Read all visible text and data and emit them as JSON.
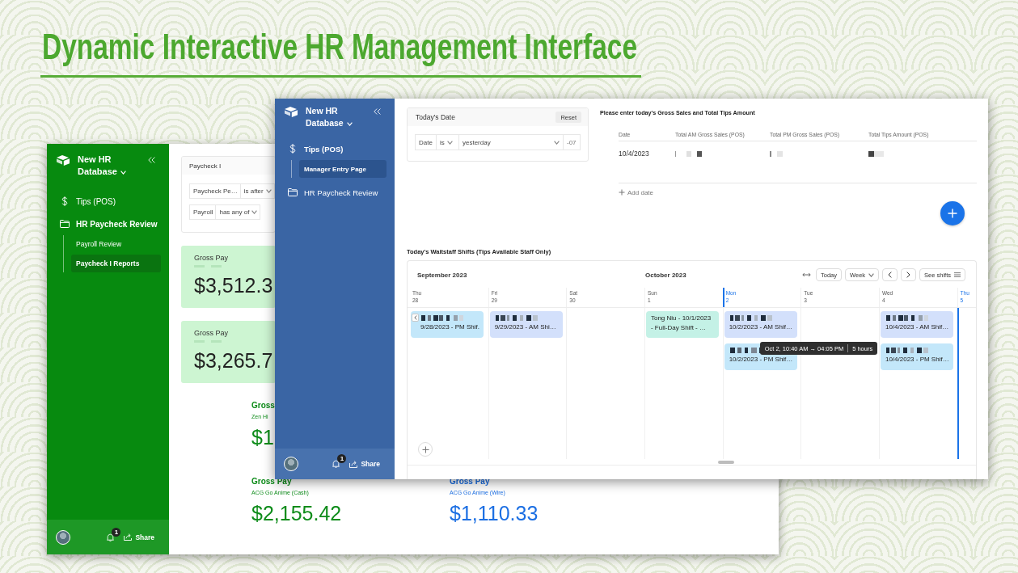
{
  "title": "Dynamic Interactive HR Management Interface",
  "back_window": {
    "sidebar": {
      "workspace": "New HR Database",
      "items": [
        {
          "kind": "dollar",
          "label": "Tips (POS)"
        },
        {
          "kind": "folder",
          "label": "HR Paycheck Review",
          "children": [
            {
              "label": "Payroll Review",
              "selected": false
            },
            {
              "label": "Paycheck I Reports",
              "selected": true
            }
          ]
        }
      ],
      "notification_count": "1",
      "share": "Share"
    },
    "filter_panel": {
      "title": "Paycheck I",
      "filters": [
        {
          "field": "Paycheck Pe…",
          "operator": "is after"
        },
        {
          "field": "Payroll",
          "operator": "has any of"
        }
      ]
    },
    "cards": [
      {
        "label": "Gross Pay",
        "subtitle_redacted": true,
        "value": "$3,512.3"
      },
      {
        "label": "Gross Pay",
        "subtitle_redacted": true,
        "value": "$3,265.7"
      }
    ],
    "metric_rows": [
      [
        {
          "label": "Gross",
          "subtitle": "Zen Hi",
          "value": "$1",
          "color": "#0e8c1a"
        }
      ],
      [
        {
          "label": "Gross Pay",
          "subtitle": "ACG Go Anime (Cash)",
          "value": "$2,155.42",
          "color": "#0e8c1a"
        },
        {
          "label": "Gross Pay",
          "subtitle": "ACG Go Anime (Wire)",
          "value": "$1,110.33",
          "color": "#1c6fe3"
        }
      ]
    ]
  },
  "front_window": {
    "sidebar": {
      "workspace": "New HR Database",
      "items": [
        {
          "kind": "dollar",
          "label": "Tips (POS)",
          "children": [
            {
              "label": "Manager Entry Page",
              "selected": true
            }
          ]
        },
        {
          "kind": "folder",
          "label": "HR Paycheck Review"
        }
      ],
      "notification_count": "1",
      "share": "Share"
    },
    "date_filter": {
      "title": "Today's Date",
      "reset": "Reset",
      "filters": [
        {
          "field": "Date",
          "operator": "is",
          "value": "yesterday",
          "suffix": "-07"
        }
      ]
    },
    "sales_entry": {
      "heading": "Please enter today's Gross Sales and Total Tips Amount",
      "columns": [
        "Date",
        "Total AM Gross Sales (POS)",
        "Total PM Gross Sales (POS)",
        "Total Tips Amount (POS)"
      ],
      "rows": [
        {
          "cells": [
            {
              "kind": "text",
              "text": "10/4/2023"
            },
            {
              "kind": "redacted"
            },
            {
              "kind": "redacted"
            },
            {
              "kind": "redacted"
            }
          ]
        }
      ],
      "add_label": "Add date"
    },
    "shifts": {
      "heading": "Today's Waitstaff Shifts (Tips Available Staff Only)",
      "calendar": {
        "months": [
          "September 2023",
          "October 2023"
        ],
        "today_button": "Today",
        "view": "Week",
        "see_shifts": "See shifts",
        "days": [
          {
            "name": "Thu",
            "date": "28",
            "highlighted": false,
            "day_marker": false,
            "now_line": false,
            "shifts": [
              {
                "redacted": true,
                "continued": true,
                "text": "9/28/2023 - PM Shif.",
                "color": "#c3e7fa"
              }
            ]
          },
          {
            "name": "Fri",
            "date": "29",
            "highlighted": false,
            "day_marker": false,
            "now_line": false,
            "shifts": [
              {
                "redacted": true,
                "continued": false,
                "text": "9/29/2023 - AM Shi…",
                "color": "#d3e0fb"
              }
            ]
          },
          {
            "name": "Sat",
            "date": "30",
            "highlighted": false,
            "day_marker": false,
            "now_line": false
          },
          {
            "name": "Sun",
            "date": "1",
            "highlighted": false,
            "day_marker": false,
            "now_line": false,
            "shifts": [
              {
                "redacted": false,
                "continued": false,
                "text": "Tong Niu - 10/1/2023\n- Full-Day Shift - …",
                "color": "#c4f1e6"
              }
            ]
          },
          {
            "name": "Mon",
            "date": "2",
            "highlighted": true,
            "day_marker": true,
            "now_line": false,
            "shifts": [
              {
                "redacted": true,
                "continued": false,
                "text": "10/2/2023 - AM Shif…",
                "color": "#d3e0fb"
              },
              {
                "redacted": true,
                "continued": false,
                "text": "10/2/2023 - PM Shif…",
                "color": "#c3e7fa",
                "tooltip": {
                  "range": "Oct 2, 10:40 AM → 04:05 PM",
                  "duration": "5 hours"
                }
              }
            ]
          },
          {
            "name": "Tue",
            "date": "3",
            "highlighted": false,
            "day_marker": false,
            "now_line": false
          },
          {
            "name": "Wed",
            "date": "4",
            "highlighted": false,
            "day_marker": false,
            "now_line": false,
            "shifts": [
              {
                "redacted": true,
                "continued": false,
                "text": "10/4/2023 - AM Shif…",
                "color": "#d3e0fb"
              },
              {
                "redacted": true,
                "continued": false,
                "text": "10/4/2023 - PM Shif…",
                "color": "#c3e7fa"
              }
            ]
          },
          {
            "name": "Thu",
            "date": "5",
            "highlighted": true,
            "day_marker": false,
            "now_line": true
          }
        ]
      }
    }
  }
}
